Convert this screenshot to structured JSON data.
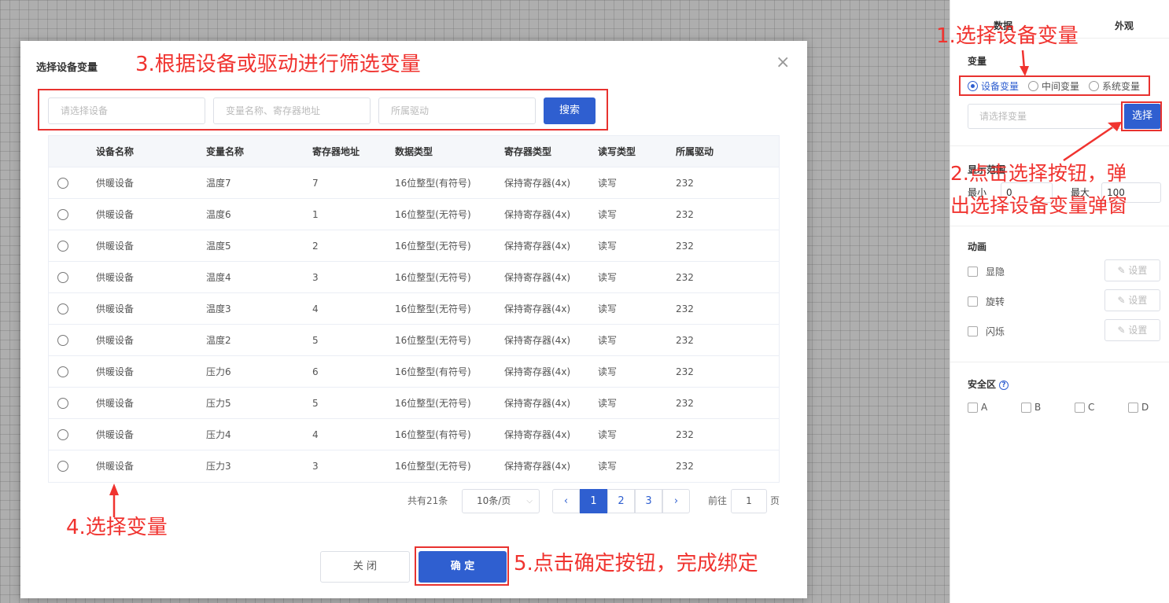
{
  "panel": {
    "tabs": [
      "数据",
      "外观"
    ],
    "variable_section": "变量",
    "radio_options": [
      {
        "label": "设备变量",
        "selected": true
      },
      {
        "label": "中间变量",
        "selected": false
      },
      {
        "label": "系统变量",
        "selected": false
      }
    ],
    "variable_placeholder": "请选择变量",
    "select_button": "选择",
    "range_section": "显示范围",
    "min_label": "最小",
    "min_value": "0",
    "max_label": "最大",
    "max_value": "100",
    "animation_section": "动画",
    "animations": [
      {
        "label": "显隐",
        "button": "设置"
      },
      {
        "label": "旋转",
        "button": "设置"
      },
      {
        "label": "闪烁",
        "button": "设置"
      }
    ],
    "safe_section": "安全区",
    "safe_options": [
      "A",
      "B",
      "C",
      "D"
    ]
  },
  "dialog": {
    "title": "选择设备变量",
    "filters": {
      "device_placeholder": "请选择设备",
      "variable_placeholder": "变量名称、寄存器地址",
      "driver_placeholder": "所属驱动",
      "search_button": "搜索"
    },
    "table": {
      "columns": [
        "设备名称",
        "变量名称",
        "寄存器地址",
        "数据类型",
        "寄存器类型",
        "读写类型",
        "所属驱动"
      ],
      "rows": [
        [
          "供暖设备",
          "温度7",
          "7",
          "16位整型(有符号)",
          "保持寄存器(4x)",
          "读写",
          "232"
        ],
        [
          "供暖设备",
          "温度6",
          "1",
          "16位整型(无符号)",
          "保持寄存器(4x)",
          "读写",
          "232"
        ],
        [
          "供暖设备",
          "温度5",
          "2",
          "16位整型(无符号)",
          "保持寄存器(4x)",
          "读写",
          "232"
        ],
        [
          "供暖设备",
          "温度4",
          "3",
          "16位整型(无符号)",
          "保持寄存器(4x)",
          "读写",
          "232"
        ],
        [
          "供暖设备",
          "温度3",
          "4",
          "16位整型(无符号)",
          "保持寄存器(4x)",
          "读写",
          "232"
        ],
        [
          "供暖设备",
          "温度2",
          "5",
          "16位整型(无符号)",
          "保持寄存器(4x)",
          "读写",
          "232"
        ],
        [
          "供暖设备",
          "压力6",
          "6",
          "16位整型(有符号)",
          "保持寄存器(4x)",
          "读写",
          "232"
        ],
        [
          "供暖设备",
          "压力5",
          "5",
          "16位整型(无符号)",
          "保持寄存器(4x)",
          "读写",
          "232"
        ],
        [
          "供暖设备",
          "压力4",
          "4",
          "16位整型(有符号)",
          "保持寄存器(4x)",
          "读写",
          "232"
        ],
        [
          "供暖设备",
          "压力3",
          "3",
          "16位整型(无符号)",
          "保持寄存器(4x)",
          "读写",
          "232"
        ]
      ]
    },
    "pagination": {
      "total": "共有21条",
      "page_size": "10条/页",
      "pages": [
        "1",
        "2",
        "3"
      ],
      "current_page": "1",
      "goto_label": "前往",
      "goto_value": "1",
      "page_suffix": "页",
      "prev": "‹",
      "next": "›"
    },
    "cancel_button": "关 闭",
    "confirm_button": "确 定",
    "close_glyph": "×"
  },
  "annotations": {
    "step1": "1.选择设备变量",
    "step2_line1": "2.点击选择按钮，弹",
    "step2_line2": "出选择设备变量弹窗",
    "step3": "3.根据设备或驱动进行筛选变量",
    "step4": "4.选择变量",
    "step5": "5.点击确定按钮，完成绑定"
  },
  "colors": {
    "accent": "#2f5fd0",
    "annotation": "#f0332f"
  }
}
